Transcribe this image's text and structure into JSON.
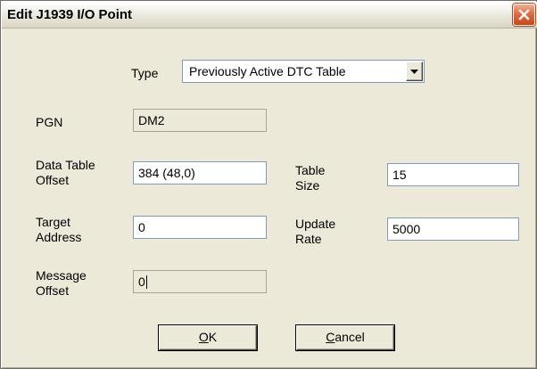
{
  "window": {
    "title": "Edit J1939 I/O Point",
    "close_icon": "close-x-icon"
  },
  "type": {
    "label": "Type",
    "value": "Previously Active DTC Table"
  },
  "pgn": {
    "label": "PGN",
    "value": "DM2"
  },
  "data_table_offset": {
    "label_line1": "Data Table",
    "label_line2": "Offset",
    "value": "384 (48,0)"
  },
  "table_size": {
    "label_line1": "Table",
    "label_line2": "Size",
    "value": "15"
  },
  "target_address": {
    "label_line1": "Target",
    "label_line2": "Address",
    "value": "0"
  },
  "update_rate": {
    "label_line1": "Update",
    "label_line2": "Rate",
    "value": "5000"
  },
  "message_offset": {
    "label_line1": "Message",
    "label_line2": "Offset",
    "value": "0"
  },
  "buttons": {
    "ok_mnemonic": "O",
    "ok_rest": "K",
    "cancel_mnemonic": "C",
    "cancel_rest": "ancel"
  },
  "colors": {
    "dialog_bg": "#ece9d8",
    "close_button": "#e36b42",
    "field_border": "#7f9db9"
  }
}
